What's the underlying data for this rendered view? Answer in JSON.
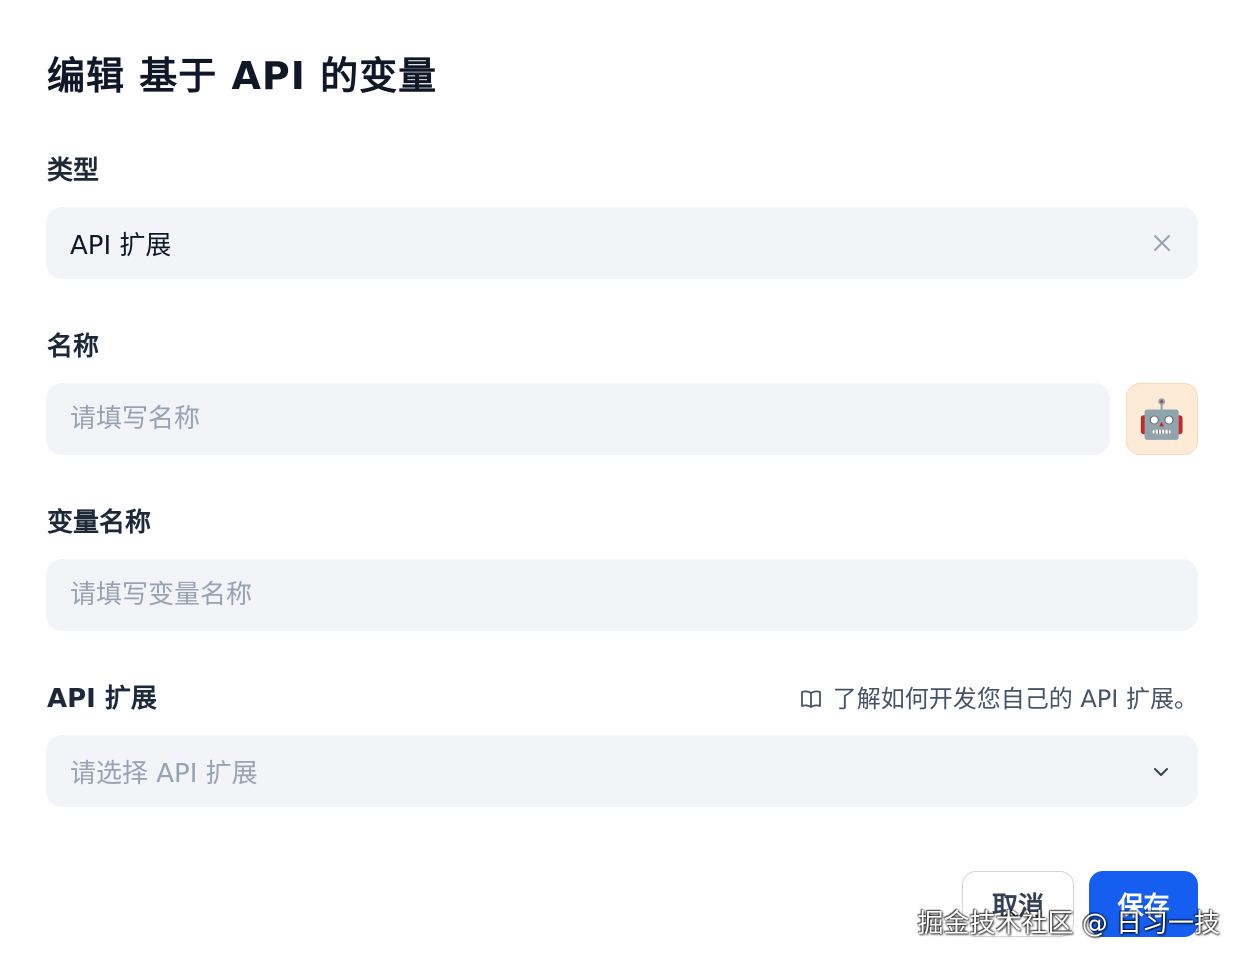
{
  "dialog": {
    "title": "编辑 基于 API 的变量"
  },
  "type_field": {
    "label": "类型",
    "value": "API 扩展",
    "clear_icon": "close-icon"
  },
  "name_field": {
    "label": "名称",
    "placeholder": "请填写名称",
    "value": "",
    "emoji": "🤖"
  },
  "variable_name_field": {
    "label": "变量名称",
    "placeholder": "请填写变量名称",
    "value": ""
  },
  "api_extension_field": {
    "label": "API 扩展",
    "help_link": "了解如何开发您自己的 API 扩展。",
    "help_icon": "book-icon",
    "placeholder": "请选择 API 扩展",
    "dropdown_icon": "chevron-down-icon"
  },
  "actions": {
    "cancel_label": "取消",
    "save_label": "保存"
  },
  "watermark": "掘金技术社区 @ 日习一技",
  "colors": {
    "primary": "#155eef",
    "field_background": "#f2f4f7",
    "placeholder": "#98a2b3",
    "emoji_background": "#fdebd8"
  }
}
